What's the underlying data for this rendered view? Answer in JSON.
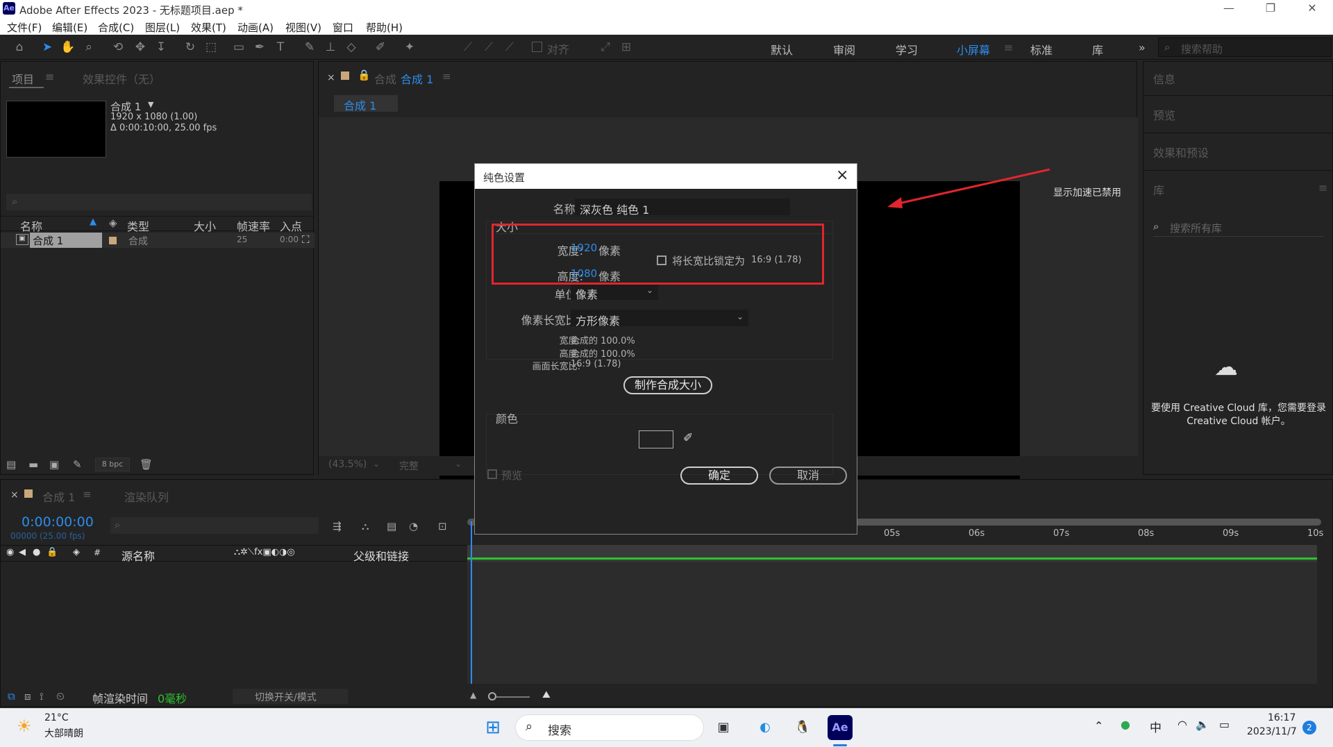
{
  "window": {
    "title": "Adobe After Effects 2023 - 无标题项目.aep *",
    "app_badge": "Ae",
    "min_icon": "minimize-icon",
    "restore_icon": "restore-icon",
    "close_icon": "close-icon"
  },
  "menu": [
    "文件(F)",
    "编辑(E)",
    "合成(C)",
    "图层(L)",
    "效果(T)",
    "动画(A)",
    "视图(V)",
    "窗口",
    "帮助(H)"
  ],
  "toolbar": {
    "align_label": "对齐",
    "workspaces": [
      "默认",
      "审阅",
      "学习",
      "小屏幕",
      "标准",
      "库"
    ],
    "active_workspace": "小屏幕",
    "search_placeholder": "搜索帮助"
  },
  "project_panel": {
    "tab_project": "项目",
    "tab_effects": "效果控件（无）",
    "comp_name": "合成 1",
    "comp_size": "1920 x 1080 (1.00)",
    "comp_duration": "Δ 0:00:10:00, 25.00 fps",
    "columns": [
      "名称",
      "类型",
      "大小",
      "帧速率",
      "入点"
    ],
    "rows": [
      {
        "name": "合成 1",
        "type": "合成",
        "fps": "25",
        "in": "0:00"
      }
    ],
    "bpc": "8 bpc"
  },
  "comp_panel": {
    "tab_label": "合成",
    "tab_name": "合成 1",
    "breadcrumb": "合成 1",
    "accel_note": "显示加速已禁用",
    "zoom": "(43.5%)",
    "resolution": "完整"
  },
  "right_panel": {
    "tabs": [
      "信息",
      "预览",
      "效果和预设",
      "库"
    ],
    "search_placeholder": "搜索所有库",
    "cc_message": "要使用 Creative Cloud 库，您需要登录 Creative Cloud 帐户。"
  },
  "timeline": {
    "tab_comp": "合成 1",
    "tab_render": "渲染队列",
    "timecode": "0:00:00:00",
    "frames": "00000 (25.00 fps)",
    "col_source": "源名称",
    "col_parent": "父级和链接",
    "ruler": [
      "05s",
      "06s",
      "07s",
      "08s",
      "09s",
      "10s"
    ],
    "render_time_label": "帧渲染时间",
    "render_time_value": "0毫秒",
    "switch_mode": "切换开关/模式"
  },
  "dialog": {
    "title": "纯色设置",
    "name_label": "名称:",
    "name_value": "深灰色 纯色 1",
    "size_group": "大小",
    "width_label": "宽度:",
    "width_value": "1920",
    "height_label": "高度:",
    "height_value": "1080",
    "px_unit": "像素",
    "lock_label": "将长宽比锁定为",
    "lock_ratio": "16:9 (1.78)",
    "unit_label": "单位:",
    "unit_value": "像素",
    "par_label": "像素长宽比:",
    "par_value": "方形像素",
    "info_width_label": "宽度:",
    "info_width_value": "合成的 100.0%",
    "info_height_label": "高度:",
    "info_height_value": "合成的 100.0%",
    "frame_ratio_label": "画面长宽比:",
    "frame_ratio_value": "16:9 (1.78)",
    "make_comp_size": "制作合成大小",
    "color_group": "颜色",
    "preview_label": "预览",
    "ok": "确定",
    "cancel": "取消"
  },
  "taskbar": {
    "temp": "21°C",
    "weather": "大部晴朗",
    "search": "搜索",
    "lang": "中",
    "time": "16:17",
    "date": "2023/11/7",
    "badge": "2",
    "ae_label": "Ae"
  }
}
